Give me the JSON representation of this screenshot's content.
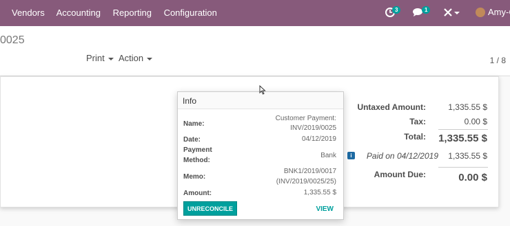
{
  "topbar": {
    "menu": [
      "Vendors",
      "Accounting",
      "Reporting",
      "Configuration"
    ],
    "activity_count": "3",
    "messages_count": "1",
    "user": "Amy-C"
  },
  "control": {
    "breadcrumb": "0025",
    "print_label": "Print",
    "action_label": "Action",
    "pager": "1 / 8"
  },
  "totals": {
    "untaxed_label": "Untaxed Amount:",
    "untaxed_value": "1,335.55 $",
    "tax_label": "Tax:",
    "tax_value": "0.00 $",
    "total_label": "Total:",
    "total_value": "1,335.55 $",
    "paid_label": "Paid on 04/12/2019",
    "paid_value": "1,335.55 $",
    "due_label": "Amount Due:",
    "due_value": "0.00 $"
  },
  "popover": {
    "title": "Info",
    "name_label": "Name:",
    "name_value_1": "Customer Payment:",
    "name_value_2": "INV/2019/0025",
    "date_label": "Date:",
    "date_value": "04/12/2019",
    "method_label_1": "Payment",
    "method_label_2": "Method:",
    "method_value": "Bank",
    "memo_label": "Memo:",
    "memo_value_1": "BNK1/2019/0017",
    "memo_value_2": "(INV/2019/0025/25)",
    "amount_label": "Amount:",
    "amount_value": "1,335.55 $",
    "unreconcile_label": "UNRECONCILE",
    "view_label": "VIEW"
  },
  "colors": {
    "topbar": "#875a7b",
    "accent": "#00a09d",
    "info_icon": "#1e6ba3"
  }
}
